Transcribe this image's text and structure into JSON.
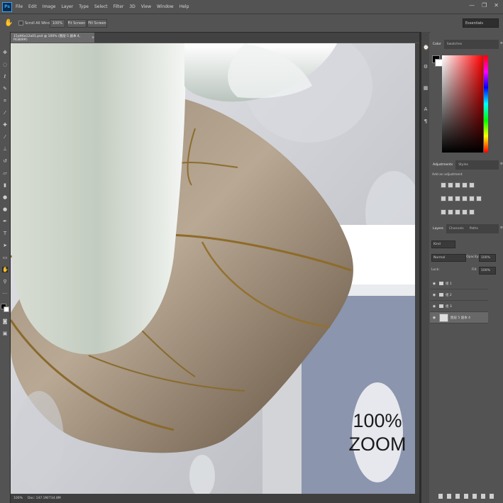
{
  "app": {
    "logo": "Ps"
  },
  "menu": [
    "File",
    "Edit",
    "Image",
    "Layer",
    "Type",
    "Select",
    "Filter",
    "3D",
    "View",
    "Window",
    "Help"
  ],
  "window_controls": {
    "minimize": "—",
    "maximize": "❐",
    "close": "✕"
  },
  "options_bar": {
    "scroll_all_label": "Scroll All Windows",
    "btn_100": "100%",
    "btn_fit": "Fit Screen",
    "btn_fill": "Fill Screen",
    "workspace": "Essentials"
  },
  "document": {
    "tab_title": "15ott6a12a01.psd @ 100% (图层 5 副本 4, RGB/8#)",
    "close": "×"
  },
  "status": {
    "zoom": "100%",
    "doc": "Doc: 147.1M/734.8M"
  },
  "panels": {
    "color_tabs": [
      "Color",
      "Swatches"
    ],
    "adjust_tabs": [
      "Adjustments",
      "Styles"
    ],
    "add_adjustment": "Add an adjustment",
    "layers_tabs": [
      "Layers",
      "Channels",
      "Paths"
    ],
    "kind": "Kind",
    "blend_mode": "Normal",
    "opacity_label": "Opacity:",
    "opacity": "100%",
    "lock_label": "Lock:",
    "fill_label": "Fill:",
    "fill": "100%",
    "layers": [
      {
        "name": "组 1",
        "type": "group",
        "selected": false
      },
      {
        "name": "组 2",
        "type": "group",
        "selected": false
      },
      {
        "name": "组 3",
        "type": "group",
        "selected": false
      },
      {
        "name": "图层 5 副本 4",
        "type": "layer",
        "selected": true
      }
    ]
  },
  "overlay": {
    "line1": "100%",
    "line2": "ZOOM"
  },
  "icons": {
    "hand": "hand-icon",
    "eye": "eye-icon",
    "menu": "panel-menu-icon"
  }
}
